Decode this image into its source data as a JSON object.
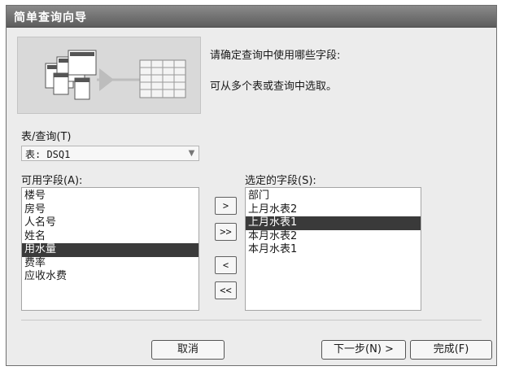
{
  "window": {
    "title": "简单查询向导"
  },
  "intro": {
    "line1": "请确定查询中使用哪些字段:",
    "line2": "可从多个表或查询中选取。"
  },
  "table_query": {
    "label": "表/查询(T)",
    "selected": "表: DSQ1"
  },
  "available_fields": {
    "label": "可用字段(A):",
    "items": [
      "楼号",
      "房号",
      "人名号",
      "姓名",
      "用水量",
      "费率",
      "应收水费"
    ],
    "selected_index": 4
  },
  "selected_fields": {
    "label": "选定的字段(S):",
    "items": [
      "部门",
      "上月水表2",
      "上月水表1",
      "本月水表2",
      "本月水表1"
    ],
    "selected_index": 2
  },
  "move_buttons": {
    "add_one": ">",
    "add_all": ">>",
    "remove_one": "<",
    "remove_all": "<<"
  },
  "footer": {
    "cancel": "取消",
    "next": "下一步(N) >",
    "finish": "完成(F)"
  }
}
